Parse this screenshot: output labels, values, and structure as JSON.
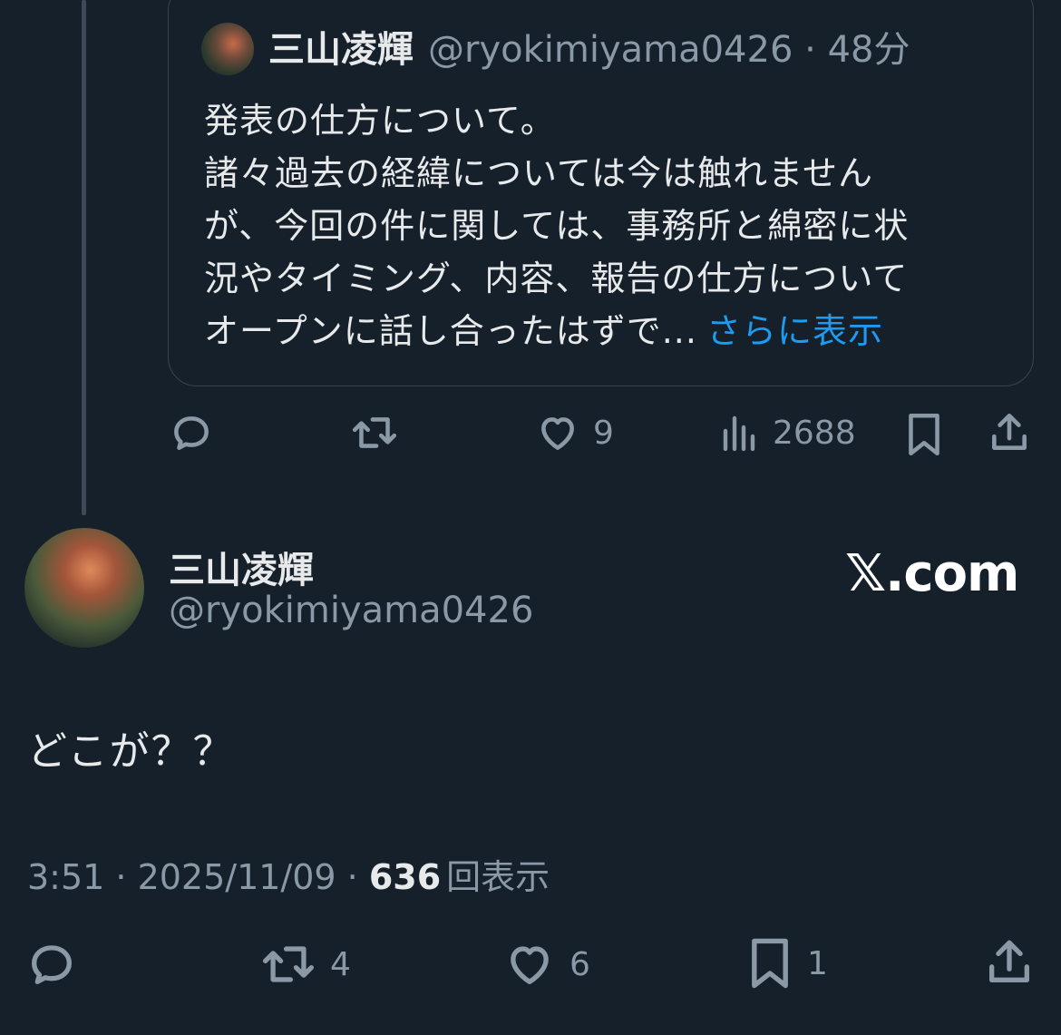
{
  "quoted_tweet": {
    "display_name": "三山凌輝",
    "handle": "@ryokimiyama0426",
    "separator": "·",
    "time": "48分",
    "body_lines": [
      "発表の仕方について。",
      "諸々過去の経緯については今は触れません",
      "が、今回の件に関しては、事務所と綿密に状",
      "況やタイミング、内容、報告の仕方について",
      "オープンに話し合ったはずで..."
    ],
    "show_more": "さらに表示",
    "actions": {
      "reply_icon": "reply-icon",
      "retweet_icon": "retweet-icon",
      "like_count": "9",
      "views_count": "2688",
      "bookmark_icon": "bookmark-icon",
      "share_icon": "share-icon"
    }
  },
  "main_tweet": {
    "display_name": "三山凌輝",
    "handle": "@ryokimiyama0426",
    "brand": "𝕏.com",
    "text": "どこが？？",
    "timestamp": "3:51 · 2025/11/09 ·",
    "views_count": "636",
    "views_label": "回表示",
    "actions": {
      "retweet_count": "4",
      "like_count": "6",
      "bookmark_count": "1"
    }
  },
  "colors": {
    "background": "#15202b",
    "text_primary": "#e7e9ea",
    "text_secondary": "#8b98a5",
    "accent": "#1d9bf0",
    "border": "#38444d"
  }
}
